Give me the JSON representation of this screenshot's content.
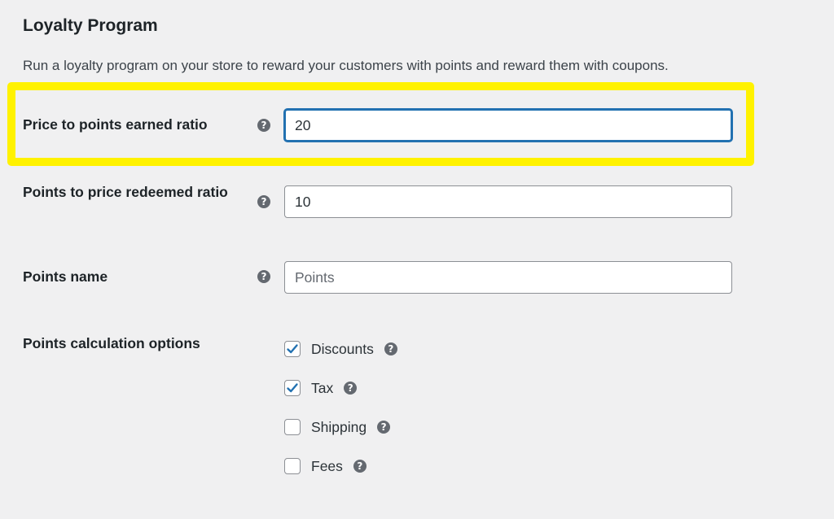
{
  "section": {
    "title": "Loyalty Program",
    "description": "Run a loyalty program on your store to reward your customers with points and reward them with coupons."
  },
  "highlight_color": "#fff200",
  "accent_color": "#2271b1",
  "help_icon": "question-mark-circle-icon",
  "fields": [
    {
      "label": "Price to points earned ratio",
      "value": "20",
      "placeholder": "",
      "focused": true,
      "highlighted": true
    },
    {
      "label": "Points to price redeemed ratio",
      "value": "10",
      "placeholder": ""
    },
    {
      "label": "Points name",
      "value": "",
      "placeholder": "Points"
    }
  ],
  "calculation_options": {
    "label": "Points calculation options",
    "options": [
      {
        "label": "Discounts",
        "checked": true
      },
      {
        "label": "Tax",
        "checked": true
      },
      {
        "label": "Shipping",
        "checked": false
      },
      {
        "label": "Fees",
        "checked": false
      }
    ]
  }
}
